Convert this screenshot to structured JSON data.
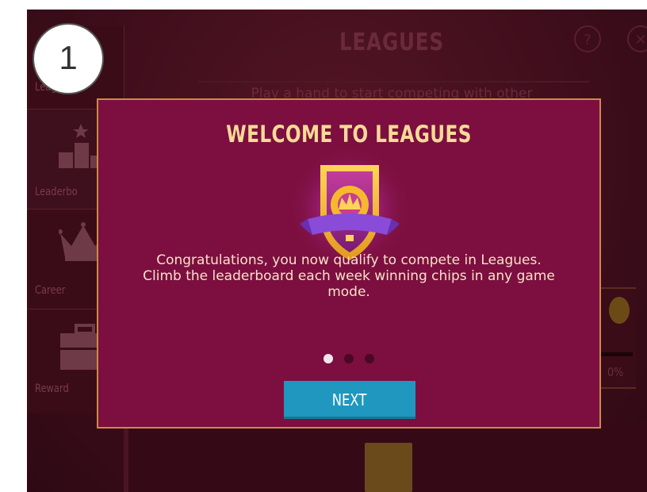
{
  "step_badge": "1",
  "header": {
    "title": "LEAGUES",
    "subtitle": "Play a hand to start competing with other",
    "help_icon_glyph": "?",
    "close_icon_glyph": "✕"
  },
  "sidebar": {
    "items": [
      {
        "label": "Leagues",
        "icon": "leagues-icon"
      },
      {
        "label": "Leaderbo",
        "icon": "podium-icon"
      },
      {
        "label": "Career",
        "icon": "crown-icon"
      },
      {
        "label": "Reward",
        "icon": "briefcase-icon"
      }
    ]
  },
  "right_panel": {
    "percent_text": "0%"
  },
  "modal": {
    "title": "WELCOME TO LEAGUES",
    "body_line1": "Congratulations, you now qualify to compete in Leagues.",
    "body_line2": "Climb the leaderboard each week winning chips in any game",
    "body_line3": "mode.",
    "pager": {
      "pages": 3,
      "current": 1
    },
    "next_label": "NEXT",
    "emblem_icon": "league-shield-crown-icon"
  },
  "colors": {
    "modal_bg": "#7c0f3f",
    "modal_border": "#c98c45",
    "title_gold": "#f9d998",
    "button_blue": "#1f97be"
  }
}
